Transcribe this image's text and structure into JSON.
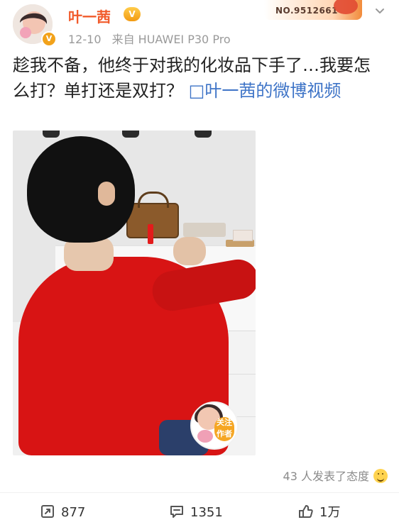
{
  "header": {
    "username": "叶一茜",
    "vip_badge": "V",
    "date": "12-10",
    "source": "来自 HUAWEI P30 Pro",
    "fan_no": "NO.9512661"
  },
  "post": {
    "text": "趁我不备，他终于对我的化妆品下手了…我要怎么打？单打还是双打？",
    "link_icon": "□",
    "link_text": "叶一茜的微博视频"
  },
  "video": {
    "follow_label": "关注\n作者"
  },
  "footer": {
    "reactions": "43 人发表了态度",
    "repost_count": "877",
    "comment_count": "1351",
    "like_count": "1万"
  },
  "colors": {
    "username": "#f15a2a",
    "link": "#3e74c7",
    "meta": "#9a9a9a"
  }
}
